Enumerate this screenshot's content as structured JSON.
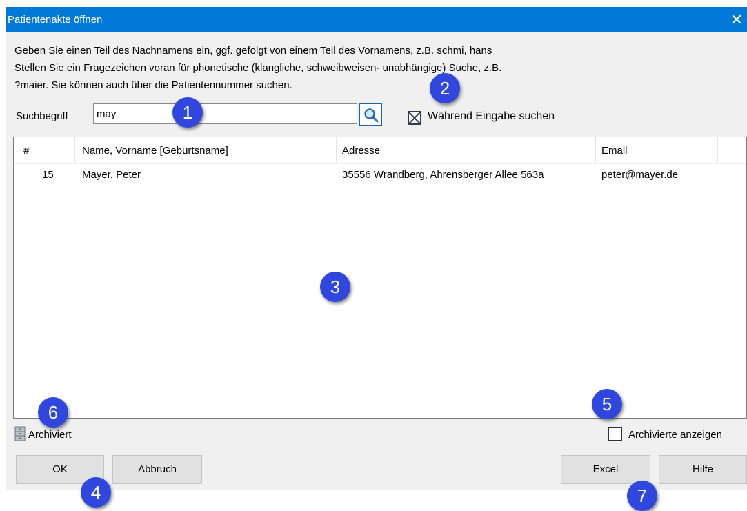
{
  "window": {
    "title": "Patientenakte öffnen",
    "close_glyph": "✕"
  },
  "instructions": [
    "Geben Sie einen Teil des Nachnamens ein, ggf. gefolgt von einem Teil des Vornamens, z.B. schmi, hans",
    "Stellen Sie ein Fragezeichen voran für phonetische (klangliche, schweibweisen- unabhängige) Suche, z.B.",
    "?maier. Sie können auch über die Patientennummer suchen."
  ],
  "search": {
    "label": "Suchbegriff",
    "value": "may",
    "button_icon": "magnifier-icon"
  },
  "live_search": {
    "label": "Während Eingabe suchen",
    "checked": true
  },
  "table": {
    "columns": [
      "#",
      "Name, Vorname [Geburtsname]",
      "Adresse",
      "Email"
    ],
    "rows": [
      {
        "num": "15",
        "name": "Mayer, Peter",
        "address": "35556 Wrandberg, Ahrensberger Allee 563a",
        "email": "peter@mayer.de"
      }
    ]
  },
  "status": {
    "archived_label": "Archiviert",
    "archived_icon": "cabinet-icon"
  },
  "show_archived": {
    "label": "Archivierte anzeigen",
    "checked": false
  },
  "buttons": {
    "ok": "OK",
    "cancel": "Abbruch",
    "excel": "Excel",
    "help": "Hilfe"
  },
  "callouts": [
    "1",
    "2",
    "3",
    "4",
    "5",
    "6",
    "7"
  ],
  "colors": {
    "titlebar": "#0078d7",
    "callout": "#2f47de"
  }
}
